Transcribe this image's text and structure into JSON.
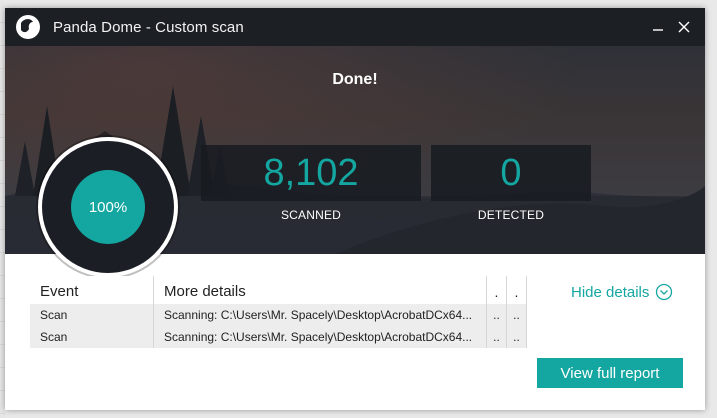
{
  "window": {
    "title": "Panda Dome - Custom scan",
    "minimize_icon": "minimize-icon",
    "close_icon": "close-icon"
  },
  "status": {
    "heading": "Done!",
    "progress_text": "100%",
    "progress_fraction": 1.0
  },
  "stats": {
    "scanned_value": "8,102",
    "scanned_label": "SCANNED",
    "detected_value": "0",
    "detected_label": "DETECTED"
  },
  "details_table": {
    "headers": {
      "event": "Event",
      "more_details": "More details",
      "col_a": ".",
      "col_b": "."
    },
    "rows": [
      {
        "event": "Scan",
        "details": "Scanning: C:\\Users\\Mr. Spacely\\Desktop\\AcrobatDCx64...",
        "col_a": "..",
        "col_b": ".."
      },
      {
        "event": "Scan",
        "details": "Scanning: C:\\Users\\Mr. Spacely\\Desktop\\AcrobatDCx64...",
        "col_a": "..",
        "col_b": ".."
      }
    ]
  },
  "actions": {
    "hide_details_label": "Hide details",
    "view_report_label": "View full report"
  },
  "colors": {
    "accent": "#14a6a0",
    "titlebar": "#1c1f24",
    "stat_box": "#181b21"
  }
}
